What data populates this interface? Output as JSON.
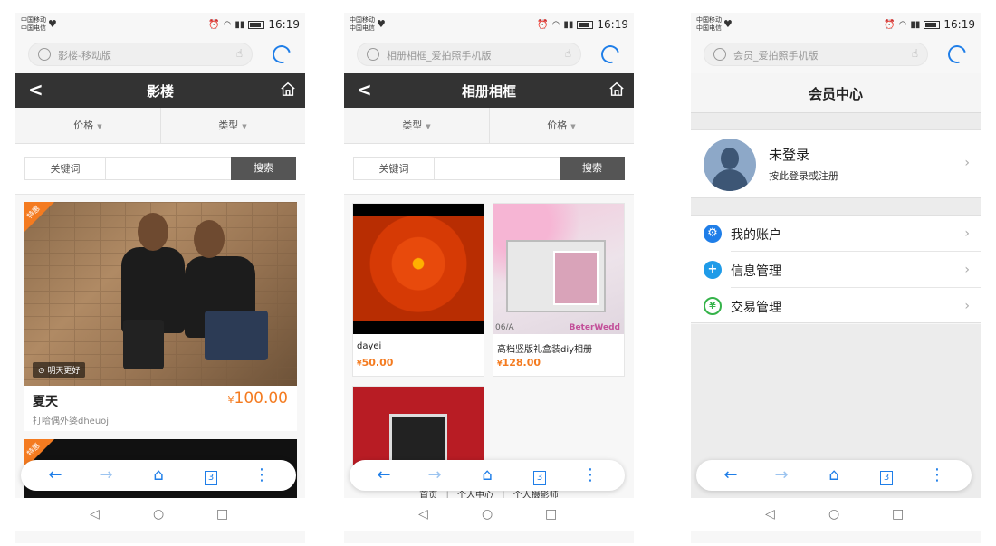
{
  "status": {
    "carrier_line1": "中国移动",
    "carrier_line2": "中国电信",
    "time": "16:19"
  },
  "colors": {
    "accent": "#1f7ee8",
    "price": "#f47b20",
    "titlebar": "#333333",
    "search_button": "#555555"
  },
  "screens": [
    {
      "url_text": "影楼-移动版",
      "title": "影楼",
      "filters": [
        "价格",
        "类型"
      ],
      "keyword_label": "关键词",
      "search_label": "搜索",
      "items": [
        {
          "badge": "特惠",
          "location": "明天更好",
          "name": "夏天",
          "price_symbol": "¥",
          "price": "100.00",
          "desc": "打哈偶外婆dheuoj"
        },
        {
          "badge": "特惠"
        }
      ],
      "tabs_count": "3"
    },
    {
      "url_text": "相册相框_爱拍照手机版",
      "title": "相册相框",
      "filters": [
        "类型",
        "价格"
      ],
      "keyword_label": "关键词",
      "search_label": "搜索",
      "items": [
        {
          "name": "dayei",
          "price_symbol": "¥",
          "price": "50.00"
        },
        {
          "name": "高档竖版礼盒装diy相册",
          "price_symbol": "¥",
          "price": "128.00",
          "image_text_code": "06/A",
          "image_text_brand": "BeterWedd"
        },
        {
          "name": ""
        }
      ],
      "footer_links": [
        "首页",
        "个人中心",
        "个人摄影师"
      ],
      "tabs_count": "3"
    },
    {
      "url_text": "会员_爱拍照手机版",
      "title": "会员中心",
      "profile": {
        "name": "未登录",
        "subtitle": "按此登录或注册"
      },
      "menu": [
        {
          "label": "我的账户",
          "icon": "gear-icon",
          "color": "#1f7ee8"
        },
        {
          "label": "信息管理",
          "icon": "plus-circle-icon",
          "color": "#1f9be8"
        },
        {
          "label": "交易管理",
          "icon": "yen-exchange-icon",
          "color": "#35b34a"
        }
      ],
      "tabs_count": "3"
    }
  ]
}
